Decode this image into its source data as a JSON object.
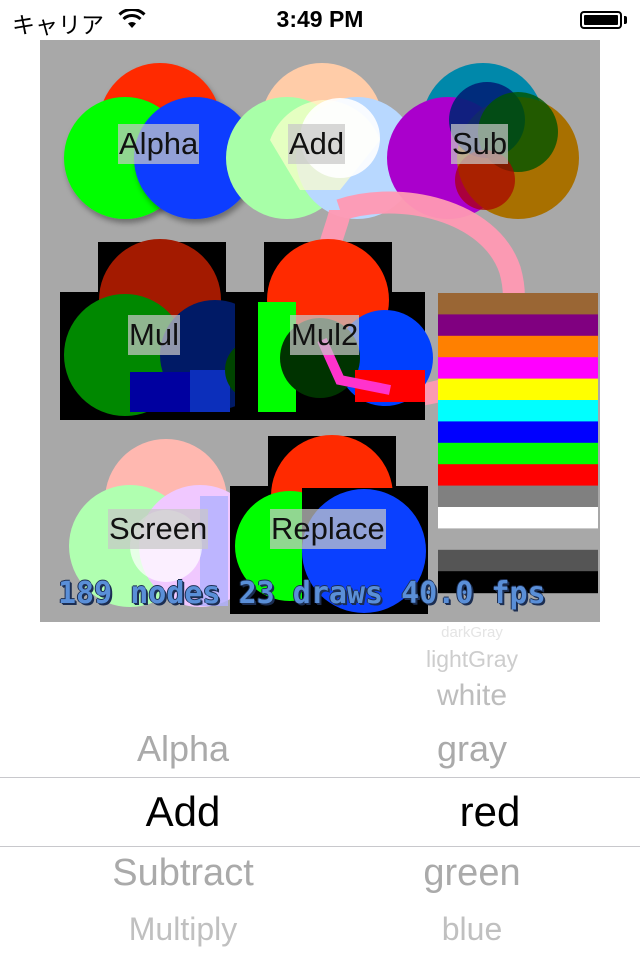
{
  "status_bar": {
    "carrier": "キャリア",
    "time": "3:49 PM",
    "wifi_icon": "wifi-icon",
    "battery_icon": "battery-full-icon"
  },
  "scene": {
    "background": "#a8a8a8",
    "labels": {
      "alpha": "Alpha",
      "add": "Add",
      "sub": "Sub",
      "mul": "Mul",
      "mul2": "Mul2",
      "screen": "Screen",
      "replace": "Replace"
    },
    "stats": "189 nodes 23 draws 40.0 fps",
    "color_bars": [
      "#9a6634",
      "#800080",
      "#ff8000",
      "#ff00ff",
      "#ffff00",
      "#00ffff",
      "#0000ff",
      "#00ff00",
      "#ff0000",
      "#808080",
      "#ffffff",
      "#a8a8a8",
      "#555555",
      "#000000"
    ]
  },
  "picker": {
    "blend_modes": {
      "above": [
        "Alpha"
      ],
      "selected": "Add",
      "below": [
        "Subtract",
        "Multiply"
      ]
    },
    "colors": {
      "above": [
        "darkGray",
        "lightGray",
        "white",
        "gray"
      ],
      "selected": "red",
      "below": [
        "green",
        "blue"
      ]
    }
  }
}
